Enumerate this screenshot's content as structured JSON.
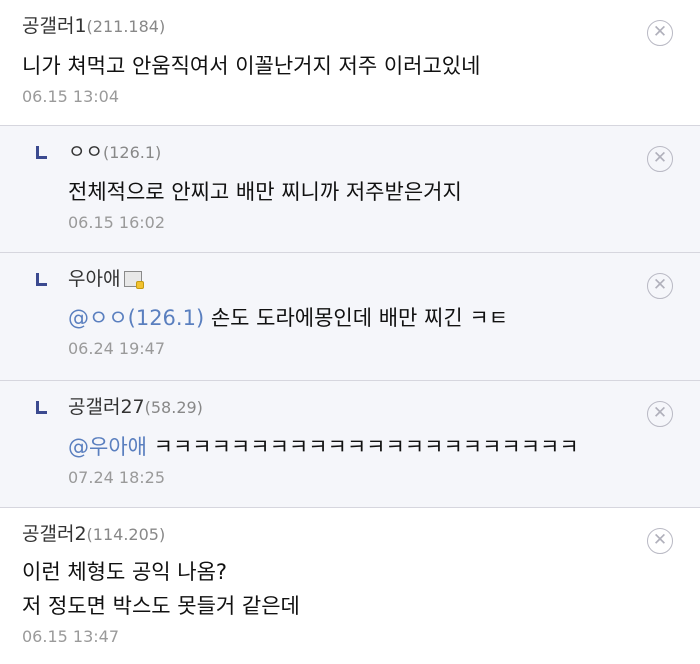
{
  "comments": [
    {
      "author": "공갤러1",
      "ip": "(211.184)",
      "body_lines": [
        "니가 쳐먹고 안움직여서 이꼴난거지 저주 이러고있네"
      ],
      "date": "06.15 13:04"
    },
    {
      "author": "ㅇㅇ",
      "ip": "(126.1)",
      "body_lines": [
        "전체적으로 안찌고 배만 찌니까 저주받은거지"
      ],
      "date": "06.15 16:02"
    },
    {
      "author": "우아애",
      "mention": "@ㅇㅇ(126.1)",
      "body_lines": [
        " 손도 도라에몽인데 배만 찌긴 ㅋㅌ"
      ],
      "date": "06.24 19:47"
    },
    {
      "author": "공갤러27",
      "ip": "(58.29)",
      "mention": "@우아애",
      "body_lines": [
        " ㅋㅋㅋㅋㅋㅋㅋㅋㅋㅋㅋㅋㅋㅋㅋㅋㅋㅋㅋㅋㅋㅋ"
      ],
      "date": "07.24 18:25"
    },
    {
      "author": "공갤러2",
      "ip": "(114.205)",
      "body_lines": [
        "이런 체형도 공익 나옴?",
        "저 정도면 박스도 못들거 같은데"
      ],
      "date": "06.15 13:47"
    }
  ],
  "icons": {
    "delete": "circle-x-icon",
    "reply": "reply-arrow-icon",
    "badge": "gallery-member-badge-icon"
  },
  "colors": {
    "mention": "#5a7fbf",
    "reply_background": "#f5f6fa",
    "reply_marker": "#3b4a8f"
  }
}
